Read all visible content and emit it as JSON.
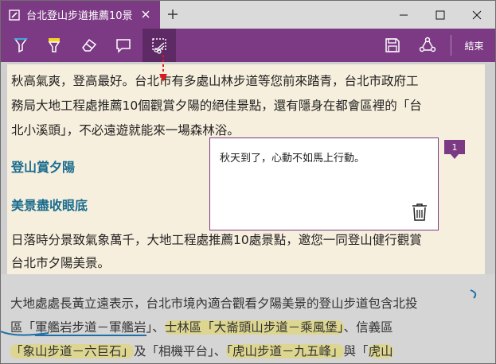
{
  "window": {
    "tab_title": "台北登山步道推薦10景",
    "new_tab_label": "+",
    "minimize": "−",
    "maximize": "□",
    "close": "✕"
  },
  "toolbar": {
    "tools": [
      "pen-icon",
      "highlighter-icon",
      "eraser-icon",
      "comment-icon",
      "clip-icon"
    ],
    "active_tool": "clip-icon",
    "save": "save-icon",
    "share": "share-icon",
    "done_label": "結束"
  },
  "article": {
    "para1": [
      "秋高氣爽，登高最好。台北市有多處山林步道等您前來踏青，台北市政府工",
      "務局大地工程處推薦10個觀賞夕陽的絕佳景點，還有隱身在都會區裡的「台",
      "北小溪頭」，不必遠遊就能來一場森林浴。"
    ],
    "heading1": "登山賞夕陽",
    "heading2": "美景盡收眼底",
    "para2": [
      "日落時分景致氣象萬千，大地工程處推薦10處景點，邀您一同登山健行觀賞",
      "台北市夕陽美景。"
    ],
    "para3_line1": "大地處處長黃立遠表示，台北市境內適合觀看夕陽美景的登山步道包含北投",
    "para3_line2_a": "區「",
    "para3_line2_b": "軍艦岩步道－軍艦岩",
    "para3_line2_c": "」、",
    "para3_line2_d": "士林區「大崙頭山步道－乘風堡」",
    "para3_line2_e": "、信義區",
    "para3_line3_a": "「象山步道－六巨石」",
    "para3_line3_b": "及「相機平台」、",
    "para3_line3_c": "「虎山步道－九五峰」",
    "para3_line3_d": "與「",
    "para3_line3_e": "虎山"
  },
  "note": {
    "text": "秋天到了，心動不如馬上行動。",
    "badge": "1"
  },
  "colors": {
    "accent": "#7b3a83",
    "heading": "#1a6c8f",
    "clip_bg": "#f7efdd",
    "highlight": "#e6d73c",
    "underline": "#1e6fa8"
  }
}
